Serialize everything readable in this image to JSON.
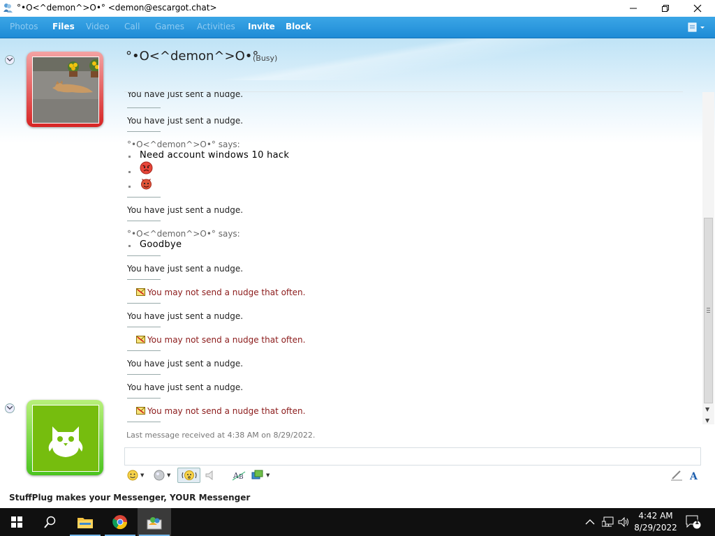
{
  "window": {
    "title": "°•O<^demon^>O•° <demon@escargot.chat>",
    "min": "—",
    "max": "☐",
    "close": "✕"
  },
  "menu": [
    {
      "label": "Photos",
      "enabled": false
    },
    {
      "label": "Files",
      "enabled": true
    },
    {
      "label": "Video",
      "enabled": false
    },
    {
      "label": "Call",
      "enabled": false
    },
    {
      "label": "Games",
      "enabled": false
    },
    {
      "label": "Activities",
      "enabled": false
    },
    {
      "label": "Invite",
      "enabled": true
    },
    {
      "label": "Block",
      "enabled": true
    }
  ],
  "contact": {
    "name": "°•O<^demon^>O•°",
    "status": "(Busy)",
    "status_color": "#d72424"
  },
  "conversation": {
    "partial_top": "You have just sent a nudge.",
    "nudge_text": "You have just sent a nudge.",
    "says_1": "°•O<^demon^>O•° says:",
    "msg_1": "Need account windows 10 hack",
    "emoticon_1": "angry-face-emoticon",
    "emoticon_2": "devil-emoticon",
    "says_2": "°•O<^demon^>O•° says:",
    "msg_2": "Goodbye",
    "warning": "You may not send a nudge that often."
  },
  "last_message": "Last message received at 4:38 AM on 8/29/2022.",
  "toolbar": {
    "icons": [
      "emoticon-icon",
      "wink-icon",
      "nudge-icon",
      "voice-clip-icon",
      "font-icon",
      "background-icon",
      "handwriting-icon",
      "text-format-icon"
    ]
  },
  "footer": "StuffPlug makes your Messenger, YOUR Messenger",
  "taskbar": {
    "time": "4:42 AM",
    "date": "8/29/2022",
    "notifications": "1"
  },
  "colors": {
    "menubar": "#2b97dc",
    "warning": "#8b1a1a",
    "busy_frame": "#d72424",
    "online_frame": "#4cc420"
  }
}
